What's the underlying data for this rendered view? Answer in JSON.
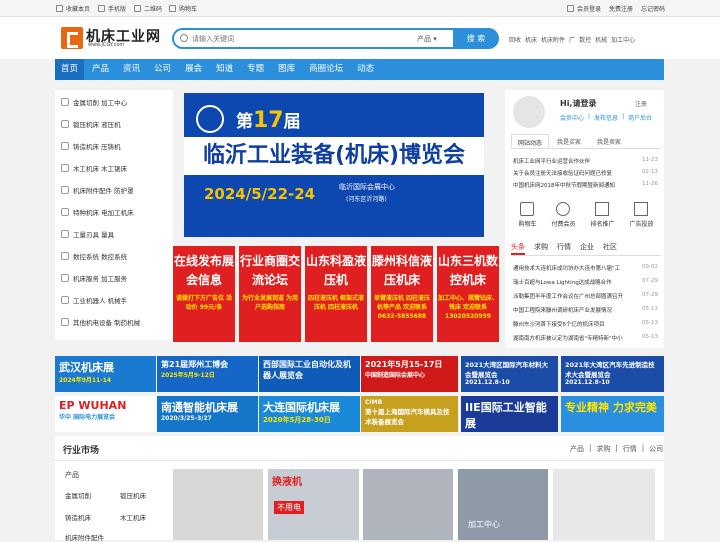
{
  "topbar": {
    "left": [
      "收藏本页",
      "手机版",
      "二维码",
      "购物车"
    ],
    "right": [
      "会员登录",
      "免费注册",
      "忘记密码"
    ]
  },
  "header": {
    "logo_title": "机床工业网",
    "logo_url": "www.JCGY.com",
    "search_placeholder": "请输入关键词",
    "search_category": "产品",
    "search_button": "搜 索",
    "hot_words": [
      "回收",
      "机床",
      "机床附件",
      "广",
      "数控",
      "机械",
      "加工中心"
    ]
  },
  "nav": [
    "首页",
    "产品",
    "资讯",
    "公司",
    "展会",
    "知道",
    "专题",
    "图库",
    "商圈论坛",
    "动态"
  ],
  "sidebar": [
    "金属切削 加工中心",
    "锻压机床 液压机",
    "铸造机床 压铸机",
    "木工机床 木工锯床",
    "机床附件配件 防护罩",
    "特种机床 电加工机床",
    "工量刃具 量具",
    "数控系统 数控系统",
    "机床服务 加工服务",
    "工业机器人 机械手",
    "其他机电设备 制药机械"
  ],
  "banner": {
    "edition": "17",
    "line1_pre": "第",
    "line1_post": "届",
    "title": "临沂工业装备(机床)博览会",
    "date": "2024/5/22-24",
    "venue": "临沂国际会展中心",
    "venue_sub": "(河东区沂河路)"
  },
  "user_panel": {
    "greeting": "Hi,请登录",
    "register": "注册",
    "links": [
      "会员中心",
      "发布信息",
      "商户后台"
    ],
    "tabs": [
      "网站动态",
      "我是买家",
      "我是卖家"
    ],
    "news": [
      {
        "t": "机床工业网平行业运营合作伙伴",
        "d": "11-23"
      },
      {
        "t": "关于会员注册无法接收验证码问题已修复",
        "d": "02-13"
      },
      {
        "t": "中国机床网2018年中秋节假期暨新闻通知",
        "d": "11-26"
      }
    ],
    "icons": [
      "购物车",
      "付费会员",
      "排名推广",
      "广告投放"
    ]
  },
  "headlines": {
    "tabs": [
      "头条",
      "求购",
      "行情",
      "企业",
      "社区"
    ],
    "items": [
      {
        "t": "通用技术大连机床成功协办大连市第八届\"工",
        "d": "09-02"
      },
      {
        "t": "瑞士百超与Lowa Lighting达成战略合作",
        "d": "07-29"
      },
      {
        "t": "派勒集团半年度工作会议在广州总部圆满召开",
        "d": "07-29"
      },
      {
        "t": "中国工程院来滕州调研机床产业发展情况",
        "d": "05-13"
      },
      {
        "t": "滕州东沙河首下接受6个亿的机床项目",
        "d": "05-13"
      },
      {
        "t": "湖南南方机床被认定为湖南省\"专精特新\"中小",
        "d": "05-13"
      }
    ]
  },
  "ads": [
    {
      "h": "在线发布展会信息",
      "s": "请拨打下方广告位 活动价 99元/条",
      "c": "#e02020"
    },
    {
      "h": "行业商圈交流论坛",
      "s": "为行业发展到道 为用户选购指南",
      "c": "#e02020"
    },
    {
      "h": "山东科盈液压机",
      "s": "四柱液压机 框架式液压机 四柱液压机",
      "c": "#e02020"
    },
    {
      "h": "滕州科信液压机床",
      "s": "单臂液压机 四柱液压机等产品 欢迎联系 0632-5855688",
      "c": "#e02020"
    },
    {
      "h": "山东三机数控机床",
      "s": "加工中心、摇臂钻床、铣床 欢迎联系 13020520999",
      "c": "#e02020"
    }
  ],
  "strips_row1": [
    {
      "t": "武汉机床展",
      "s": "2024年9月11-14",
      "c": "#1a7ad0"
    },
    {
      "t": "第21届郑州工博会",
      "s": "2025年5月9-12日",
      "c": "#1666c8"
    },
    {
      "t": "西部国际工业自动化及机器人展览会",
      "s": "",
      "c": "#0e5bb8"
    },
    {
      "t": "2021年5月15-17日",
      "s": "中国制造国际会展中心",
      "c": "#d01a1a"
    },
    {
      "t": "2021大湾区国际汽车材料大会暨展览会",
      "s": "2021.12.8-10",
      "c": "#1a4ca8"
    },
    {
      "t": "2021年大湾区汽车先进制造技术大会暨展览会",
      "s": "2021.12.8-10",
      "c": "#1a4ca8"
    }
  ],
  "strips_row2": [
    {
      "t": "EP WUHAN",
      "s": "华中 国际电力展览会",
      "c": "#ffffff"
    },
    {
      "t": "南通智能机床展",
      "s": "2020/3/25-3/27",
      "c": "#1575c8"
    },
    {
      "t": "大连国际机床展",
      "s": "2020年5月28-30日",
      "c": "#1a8ad8"
    },
    {
      "t": "第十届上海国际汽车模具及技术装备展览会",
      "s": "CIMB",
      "c": "#c8a020"
    },
    {
      "t": "IIE国际工业智能展",
      "s": "",
      "c": "#1a3c98"
    },
    {
      "t": "专业精神 力求完美",
      "s": "",
      "c": "#2a8fe0"
    }
  ],
  "market": {
    "title": "行业市场",
    "links": [
      "产品",
      "求购",
      "行情",
      "公司"
    ],
    "cat_title": "产品",
    "cats": [
      "金属切削",
      "锻压机床",
      "铸造机床",
      "木工机床",
      "机床附件配件"
    ],
    "product_labels": [
      "换液机",
      "不用电",
      "加工中心"
    ]
  }
}
